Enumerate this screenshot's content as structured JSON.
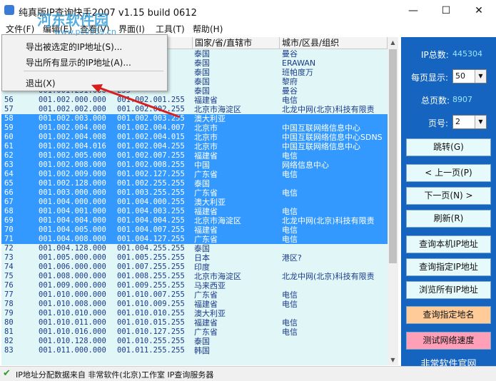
{
  "window": {
    "title": "纯真版IP查询快手2007 v1.15 build 0612",
    "min": "—",
    "max": "☐",
    "close": "✕"
  },
  "menu": [
    "文件(F)",
    "编辑(E)",
    "查看(V)",
    "界面(I)",
    "工具(T)",
    "帮助(H)"
  ],
  "dropdown": {
    "items": [
      "导出被选定的IP地址(S)...",
      "导出所有显示的IP地址(A)...",
      "退出(X)"
    ]
  },
  "table": {
    "headers": [
      "",
      "",
      "",
      "国家/省/直辖市",
      "城市/区县/组织"
    ],
    "rows": [
      {
        "n": "",
        "s": "",
        "e": "255",
        "c": "泰国",
        "o": "曼谷",
        "sel": false
      },
      {
        "n": "",
        "s": "",
        "e": "255",
        "c": "泰国",
        "o": "ERAWAN",
        "sel": false
      },
      {
        "n": "",
        "s": "",
        "e": "255",
        "c": "泰国",
        "o": "班帕度万",
        "sel": false
      },
      {
        "n": "",
        "s": "",
        "e": "255",
        "c": "泰国",
        "o": "黎府",
        "sel": false
      },
      {
        "n": "",
        "s": "001.001.231.000",
        "e": "255",
        "c": "泰国",
        "o": "曼谷",
        "sel": false
      },
      {
        "n": "56",
        "s": "001.002.000.000",
        "e": "001.002.001.255",
        "c": "福建省",
        "o": "电信",
        "sel": false
      },
      {
        "n": "57",
        "s": "001.002.002.000",
        "e": "001.002.002.255",
        "c": "北京市海淀区",
        "o": "北龙中网(北京)科技有限责",
        "sel": false
      },
      {
        "n": "58",
        "s": "001.002.003.000",
        "e": "001.002.003.255",
        "c": "澳大利亚",
        "o": "",
        "sel": true
      },
      {
        "n": "59",
        "s": "001.002.004.000",
        "e": "001.002.004.007",
        "c": "北京市",
        "o": "中国互联网络信息中心",
        "sel": true
      },
      {
        "n": "60",
        "s": "001.002.004.008",
        "e": "001.002.004.015",
        "c": "北京市",
        "o": "中国互联网络信息中心SDNS",
        "sel": true
      },
      {
        "n": "61",
        "s": "001.002.004.016",
        "e": "001.002.004.255",
        "c": "北京市",
        "o": "中国互联网络信息中心",
        "sel": true
      },
      {
        "n": "62",
        "s": "001.002.005.000",
        "e": "001.002.007.255",
        "c": "福建省",
        "o": "电信",
        "sel": true
      },
      {
        "n": "63",
        "s": "001.002.008.000",
        "e": "001.002.008.255",
        "c": "中国",
        "o": "网络信息中心",
        "sel": true
      },
      {
        "n": "64",
        "s": "001.002.009.000",
        "e": "001.002.127.255",
        "c": "广东省",
        "o": "电信",
        "sel": true
      },
      {
        "n": "65",
        "s": "001.002.128.000",
        "e": "001.002.255.255",
        "c": "泰国",
        "o": "",
        "sel": true
      },
      {
        "n": "66",
        "s": "001.003.000.000",
        "e": "001.003.255.255",
        "c": "广东省",
        "o": "电信",
        "sel": true
      },
      {
        "n": "67",
        "s": "001.004.000.000",
        "e": "001.004.000.255",
        "c": "澳大利亚",
        "o": "",
        "sel": true
      },
      {
        "n": "68",
        "s": "001.004.001.000",
        "e": "001.004.003.255",
        "c": "福建省",
        "o": "电信",
        "sel": true
      },
      {
        "n": "69",
        "s": "001.004.004.000",
        "e": "001.004.004.255",
        "c": "北京市海淀区",
        "o": "北龙中网(北京)科技有限责",
        "sel": true
      },
      {
        "n": "70",
        "s": "001.004.005.000",
        "e": "001.004.007.255",
        "c": "福建省",
        "o": "电信",
        "sel": true
      },
      {
        "n": "71",
        "s": "001.004.008.000",
        "e": "001.004.127.255",
        "c": "广东省",
        "o": "电信",
        "sel": true
      },
      {
        "n": "72",
        "s": "001.004.128.000",
        "e": "001.004.255.255",
        "c": "泰国",
        "o": "",
        "sel": false
      },
      {
        "n": "73",
        "s": "001.005.000.000",
        "e": "001.005.255.255",
        "c": "日本",
        "o": "港区?",
        "sel": false
      },
      {
        "n": "74",
        "s": "001.006.000.000",
        "e": "001.007.255.255",
        "c": "印度",
        "o": "",
        "sel": false
      },
      {
        "n": "75",
        "s": "001.008.000.000",
        "e": "001.008.255.255",
        "c": "北京市海淀区",
        "o": "北龙中网(北京)科技有限责",
        "sel": false
      },
      {
        "n": "76",
        "s": "001.009.000.000",
        "e": "001.009.255.255",
        "c": "马来西亚",
        "o": "",
        "sel": false
      },
      {
        "n": "77",
        "s": "001.010.000.000",
        "e": "001.010.007.255",
        "c": "广东省",
        "o": "电信",
        "sel": false
      },
      {
        "n": "78",
        "s": "001.010.008.000",
        "e": "001.010.009.255",
        "c": "福建省",
        "o": "电信",
        "sel": false
      },
      {
        "n": "79",
        "s": "001.010.010.000",
        "e": "001.010.010.255",
        "c": "澳大利亚",
        "o": "",
        "sel": false
      },
      {
        "n": "80",
        "s": "001.010.011.000",
        "e": "001.010.015.255",
        "c": "福建省",
        "o": "电信",
        "sel": false
      },
      {
        "n": "81",
        "s": "001.010.016.000",
        "e": "001.010.127.255",
        "c": "广东省",
        "o": "电信",
        "sel": false
      },
      {
        "n": "82",
        "s": "001.010.128.000",
        "e": "001.010.255.255",
        "c": "泰国",
        "o": "",
        "sel": false
      },
      {
        "n": "83",
        "s": "001.011.000.000",
        "e": "001.011.255.255",
        "c": "韩国",
        "o": "",
        "sel": false
      }
    ]
  },
  "side": {
    "total_label": "IP总数:",
    "total_value": "445304",
    "per_page_label": "每页显示:",
    "per_page_value": "50",
    "pages_label": "总页数:",
    "pages_value": "8907",
    "page_label": "页号:",
    "page_value": "2",
    "buttons": [
      "跳转(G)",
      "< 上一页(P)",
      "下一页(N) >",
      "刷新(R)",
      "查询本机IP地址",
      "查询指定IP地址",
      "浏览所有IP地址",
      "查询指定地名",
      "测试网络速度"
    ],
    "footer": "非常软件官网",
    "accent": "#1565c0"
  },
  "status": {
    "text": "IP地址分配数据来自 非常软件(北京)工作室 IP查询服务器"
  },
  "watermark": {
    "logo": "河东软件园",
    "url": "www.pc0359.cn"
  }
}
